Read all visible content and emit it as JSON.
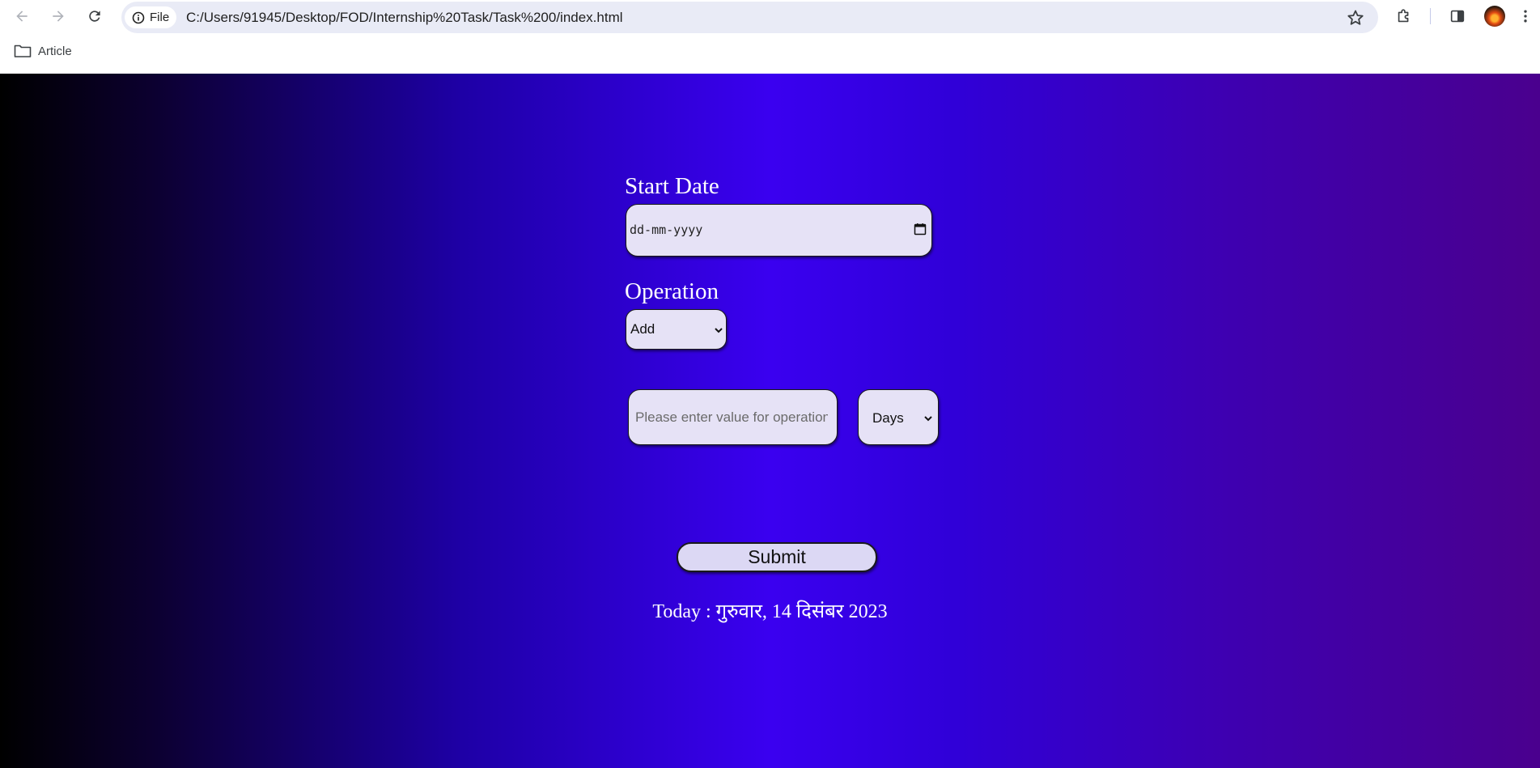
{
  "browser": {
    "site_chip_label": "File",
    "url": "C:/Users/91945/Desktop/FOD/Internship%20Task/Task%200/index.html",
    "bookmarks": [
      {
        "label": "Article"
      }
    ]
  },
  "form": {
    "start_date_label": "Start Date",
    "date_placeholder": "dd-mm-yyyy",
    "operation_label": "Operation",
    "operation_selected": "Add",
    "value_placeholder": "Please enter value for operation",
    "unit_selected": "Days",
    "submit_label": "Submit"
  },
  "today_text": "Today : गुरुवार, 14 दिसंबर 2023",
  "colors": {
    "gradient_start": "#000000",
    "gradient_mid": "#3a00f0",
    "gradient_end": "#4a008e",
    "field_bg": "#e6e2f6"
  }
}
